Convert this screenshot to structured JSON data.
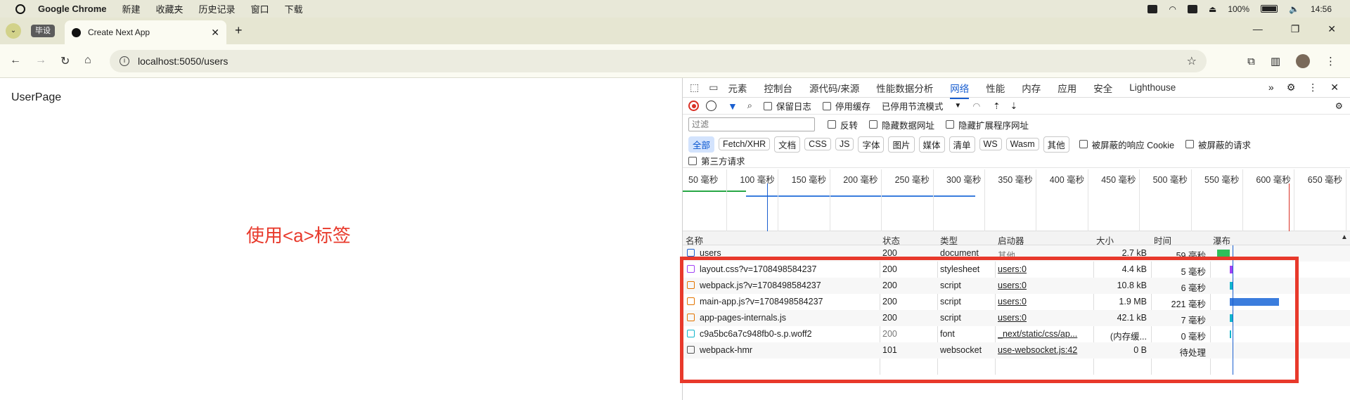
{
  "menubar": {
    "app": "Google Chrome",
    "items": [
      "新建",
      "收藏夹",
      "历史记录",
      "窗口",
      "下载"
    ],
    "battery": "100%",
    "time": "14:56"
  },
  "tabs": {
    "group_label": "毕设",
    "active_title": "Create Next App"
  },
  "address": {
    "url": "localhost:5050/users"
  },
  "page": {
    "title": "UserPage",
    "annotation": "使用<a>标签"
  },
  "devtools": {
    "tabs": [
      "元素",
      "控制台",
      "源代码/来源",
      "性能数据分析",
      "网络",
      "性能",
      "内存",
      "应用",
      "安全",
      "Lighthouse"
    ],
    "active_tab": "网络",
    "toolbar": {
      "preserve_log": "保留日志",
      "disable_cache": "停用缓存",
      "throttle": "已停用节流模式"
    },
    "filter": {
      "placeholder": "过滤",
      "invert": "反转",
      "hide_data_urls": "隐藏数据网址",
      "hide_ext_urls": "隐藏扩展程序网址",
      "types": [
        "全部",
        "Fetch/XHR",
        "文档",
        "CSS",
        "JS",
        "字体",
        "图片",
        "媒体",
        "清单",
        "WS",
        "Wasm",
        "其他"
      ],
      "blocked_cookies": "被屏蔽的响应 Cookie",
      "blocked_requests": "被屏蔽的请求",
      "third_party": "第三方请求"
    },
    "overview_ticks": [
      "50 毫秒",
      "100 毫秒",
      "150 毫秒",
      "200 毫秒",
      "250 毫秒",
      "300 毫秒",
      "350 毫秒",
      "400 毫秒",
      "450 毫秒",
      "500 毫秒",
      "550 毫秒",
      "600 毫秒",
      "650 毫秒"
    ],
    "columns": [
      "名称",
      "状态",
      "类型",
      "启动器",
      "大小",
      "时间",
      "瀑布"
    ],
    "rows": [
      {
        "name": "users",
        "status": "200",
        "type": "document",
        "initiator": "其他",
        "size": "2.7 kB",
        "time": "59 毫秒",
        "icon": "document",
        "color": "#1a5fd0"
      },
      {
        "name": "layout.css?v=1708498584237",
        "status": "200",
        "type": "stylesheet",
        "initiator": "users:0",
        "size": "4.4 kB",
        "time": "5 毫秒",
        "icon": "stylesheet",
        "color": "#a142f4"
      },
      {
        "name": "webpack.js?v=1708498584237",
        "status": "200",
        "type": "script",
        "initiator": "users:0",
        "size": "10.8 kB",
        "time": "6 毫秒",
        "icon": "script",
        "color": "#e37400"
      },
      {
        "name": "main-app.js?v=1708498584237",
        "status": "200",
        "type": "script",
        "initiator": "users:0",
        "size": "1.9 MB",
        "time": "221 毫秒",
        "icon": "script",
        "color": "#e37400"
      },
      {
        "name": "app-pages-internals.js",
        "status": "200",
        "type": "script",
        "initiator": "users:0",
        "size": "42.1 kB",
        "time": "7 毫秒",
        "icon": "script",
        "color": "#e37400"
      },
      {
        "name": "c9a5bc6a7c948fb0-s.p.woff2",
        "status": "200",
        "type": "font",
        "initiator": "_next/static/css/ap...",
        "size": "(内存缓...",
        "time": "0 毫秒",
        "icon": "font",
        "color": "#12b5cb"
      },
      {
        "name": "webpack-hmr",
        "status": "101",
        "type": "websocket",
        "initiator": "use-websocket.js:42",
        "size": "0 B",
        "time": "待处理",
        "icon": "websocket",
        "color": "#555555"
      }
    ]
  }
}
